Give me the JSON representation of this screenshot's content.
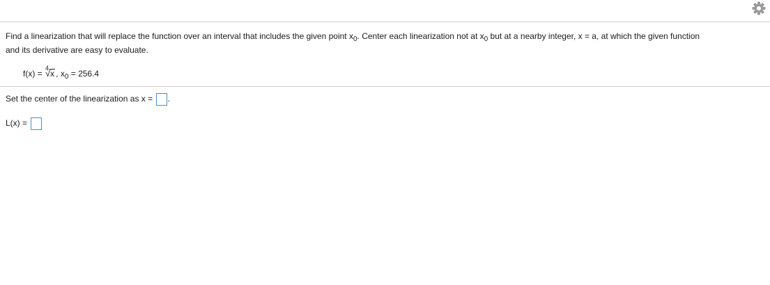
{
  "toolbar": {
    "settings_icon": "gear-icon"
  },
  "question": {
    "line1_a": "Find a linearization that will replace the function over an interval that includes the given point x",
    "line1_a_sub": "0",
    "line1_b": ". Center each linearization not at x",
    "line1_b_sub": "0",
    "line1_c": " but at a nearby integer, x = a, at which the given function",
    "line2": "and its derivative are easy to evaluate."
  },
  "formula": {
    "fx_prefix": "f(x) = ",
    "root_index": "4",
    "radical_sign": "√",
    "radicand": "x",
    "comma": ", x",
    "x0_sub": "0",
    "x0_value": " = 256.4"
  },
  "prompts": {
    "center_label": "Set the center of the linearization as x = ",
    "center_suffix": ".",
    "center_value": "",
    "lx_label": "L(x) = ",
    "lx_value": ""
  },
  "colors": {
    "input_border": "#3f8fd6",
    "gear": "#9a9a9a",
    "divider": "#cfcfcf"
  }
}
